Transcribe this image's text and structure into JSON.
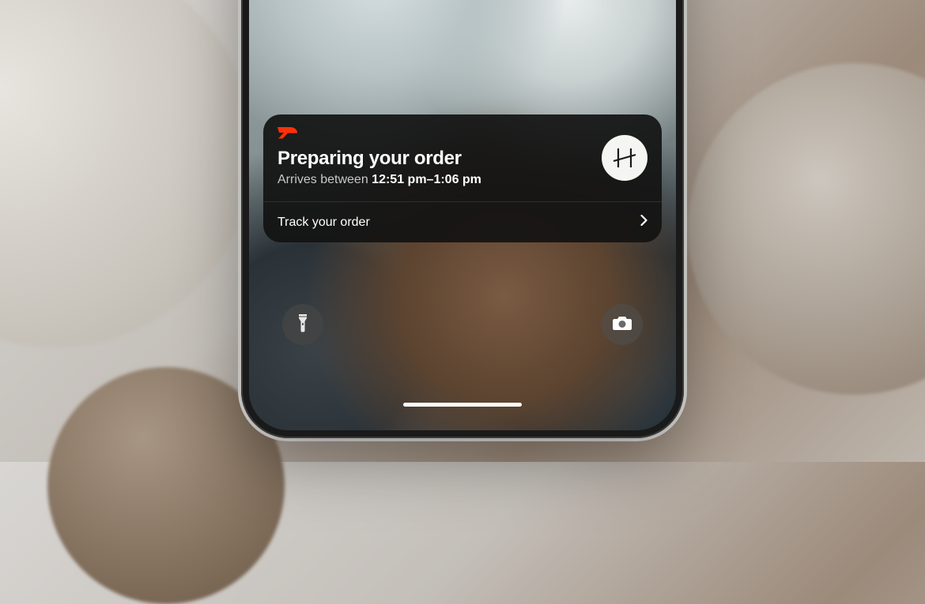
{
  "notification": {
    "app": "DoorDash",
    "title": "Preparing your order",
    "subtitle_prefix": "Arrives between ",
    "eta": "12:51 pm–1:06 pm",
    "action_label": "Track your order",
    "merchant_initial": "H"
  },
  "lockscreen": {
    "flashlight": "Flashlight",
    "camera": "Camera"
  },
  "colors": {
    "doordash_red": "#ff3008",
    "card_bg": "rgba(18,18,18,0.92)"
  }
}
